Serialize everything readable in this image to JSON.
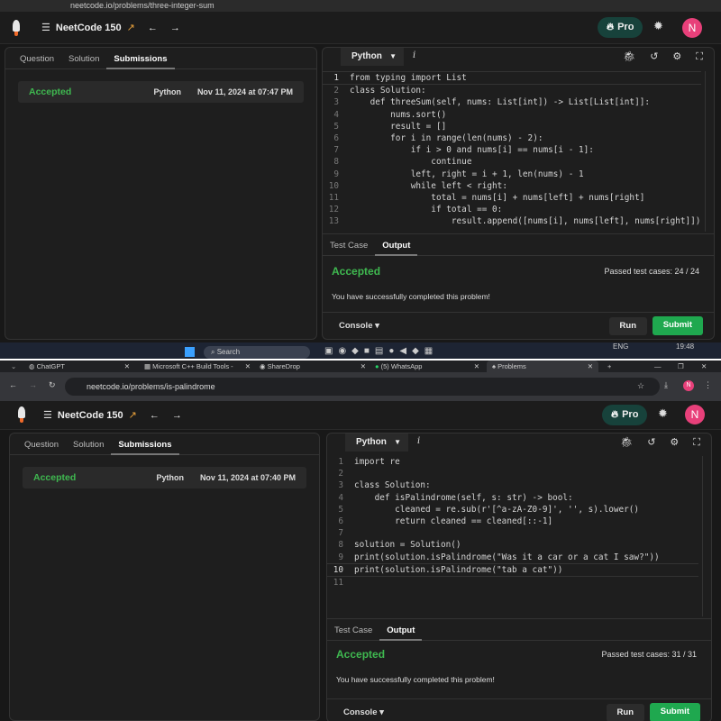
{
  "top": {
    "url": "neetcode.io/problems/three-integer-sum",
    "app": {
      "title": "NeetCode 150",
      "pro": "Pro",
      "avatar": "N"
    },
    "tabs": [
      "Question",
      "Solution",
      "Submissions"
    ],
    "submission": {
      "status": "Accepted",
      "language": "Python",
      "date": "Nov 11, 2024 at 07:47 PM"
    },
    "editor": {
      "language": "Python",
      "info": "i",
      "lines": [
        "from typing import List",
        "class Solution:",
        "    def threeSum(self, nums: List[int]) -> List[List[int]]:",
        "        nums.sort()",
        "        result = []",
        "        for i in range(len(nums) - 2):",
        "            if i > 0 and nums[i] == nums[i - 1]:",
        "                continue",
        "            left, right = i + 1, len(nums) - 1",
        "            while left < right:",
        "                total = nums[i] + nums[left] + nums[right]",
        "                if total == 0:",
        "                    result.append([nums[i], nums[left], nums[right]])"
      ]
    },
    "io_tabs": [
      "Test Case",
      "Output"
    ],
    "result": {
      "status": "Accepted",
      "passed": "Passed test cases: 24 / 24",
      "message": "You have successfully completed this problem!"
    },
    "footer": {
      "console": "Console",
      "run": "Run",
      "submit": "Submit"
    },
    "taskbar": {
      "search": "Search",
      "lang": "ENG",
      "time": "19:48"
    }
  },
  "bottom": {
    "browser_tabs": [
      "ChatGPT",
      "Microsoft C++ Build Tools -",
      "ShareDrop",
      "(5) WhatsApp",
      "Problems"
    ],
    "url": "neetcode.io/problems/is-palindrome",
    "app": {
      "title": "NeetCode 150",
      "pro": "Pro",
      "avatar": "N"
    },
    "tabs": [
      "Question",
      "Solution",
      "Submissions"
    ],
    "submission": {
      "status": "Accepted",
      "language": "Python",
      "date": "Nov 11, 2024 at 07:40 PM"
    },
    "editor": {
      "language": "Python",
      "info": "i",
      "lines": [
        "import re",
        "",
        "class Solution:",
        "    def isPalindrome(self, s: str) -> bool:",
        "        cleaned = re.sub(r'[^a-zA-Z0-9]', '', s).lower()",
        "        return cleaned == cleaned[::-1]",
        "",
        "solution = Solution()",
        "print(solution.isPalindrome(\"Was it a car or a cat I saw?\"))",
        "print(solution.isPalindrome(\"tab a cat\"))",
        ""
      ]
    },
    "io_tabs": [
      "Test Case",
      "Output"
    ],
    "result": {
      "status": "Accepted",
      "passed": "Passed test cases: 31 / 31",
      "message": "You have successfully completed this problem!"
    },
    "footer": {
      "console": "Console",
      "run": "Run",
      "submit": "Submit"
    }
  }
}
